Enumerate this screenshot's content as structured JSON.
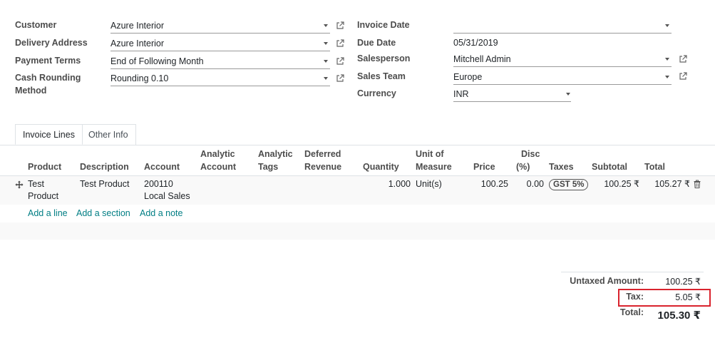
{
  "form": {
    "customer": {
      "label": "Customer",
      "value": "Azure Interior"
    },
    "delivery_address": {
      "label": "Delivery Address",
      "value": "Azure Interior"
    },
    "payment_terms": {
      "label": "Payment Terms",
      "value": "End of Following Month"
    },
    "cash_rounding": {
      "label_line1": "Cash Rounding",
      "label_line2": "Method",
      "value": "Rounding 0.10"
    },
    "invoice_date": {
      "label": "Invoice Date",
      "value": ""
    },
    "due_date": {
      "label": "Due Date",
      "value": "05/31/2019"
    },
    "salesperson": {
      "label": "Salesperson",
      "value": "Mitchell Admin"
    },
    "sales_team": {
      "label": "Sales Team",
      "value": "Europe"
    },
    "currency": {
      "label": "Currency",
      "value": "INR"
    }
  },
  "tabs": [
    {
      "label": "Invoice Lines",
      "active": true
    },
    {
      "label": "Other Info",
      "active": false
    }
  ],
  "table": {
    "headers": {
      "product": "Product",
      "description": "Description",
      "account": "Account",
      "analytic_account_1": "Analytic",
      "analytic_account_2": "Account",
      "analytic_tags_1": "Analytic",
      "analytic_tags_2": "Tags",
      "deferred_revenue_1": "Deferred",
      "deferred_revenue_2": "Revenue",
      "quantity": "Quantity",
      "uom_1": "Unit of",
      "uom_2": "Measure",
      "price": "Price",
      "disc_1": "Disc",
      "disc_2": "(%)",
      "taxes": "Taxes",
      "subtotal": "Subtotal",
      "total": "Total"
    },
    "rows": [
      {
        "product_1": "Test",
        "product_2": "Product",
        "description": "Test Product",
        "account_1": "200110",
        "account_2": "Local Sales",
        "quantity": "1.000",
        "uom": "Unit(s)",
        "price": "100.25",
        "disc": "0.00",
        "tax": "GST 5%",
        "subtotal": "100.25 ₹",
        "total": "105.27 ₹"
      }
    ],
    "actions": {
      "add_line": "Add a line",
      "add_section": "Add a section",
      "add_note": "Add a note"
    }
  },
  "totals": {
    "untaxed_label": "Untaxed Amount:",
    "untaxed_value": "100.25 ₹",
    "tax_label": "Tax:",
    "tax_value": "5.05 ₹",
    "total_label": "Total:",
    "total_value": "105.30 ₹"
  },
  "colors": {
    "link": "#017e84",
    "highlight": "#d9232d"
  }
}
